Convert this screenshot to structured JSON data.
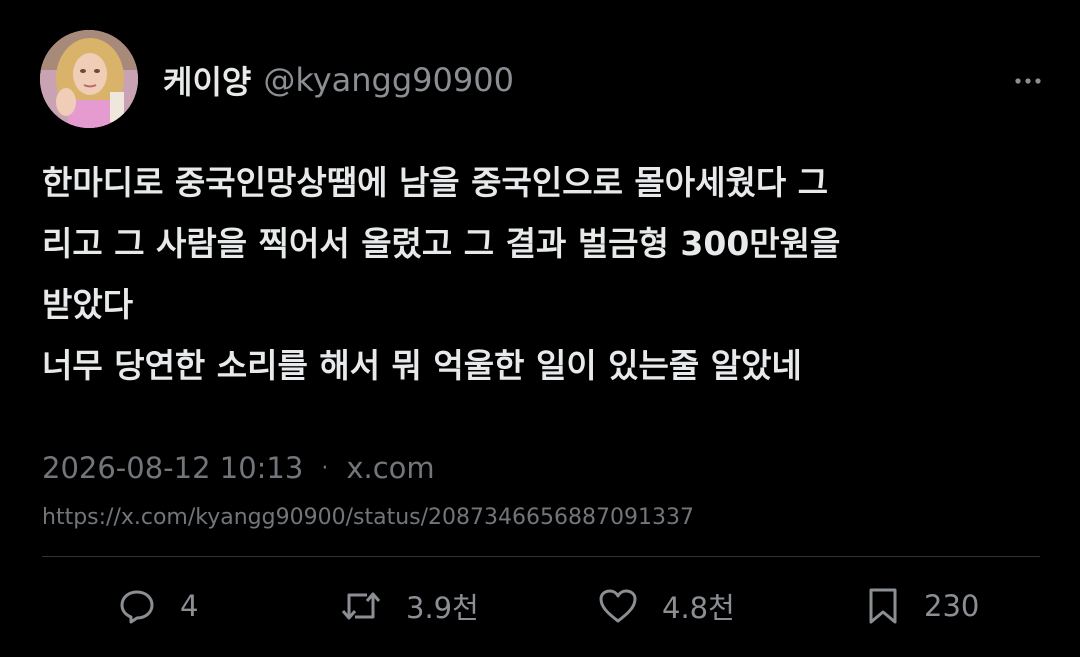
{
  "author": {
    "display_name": "케이양",
    "handle": "@kyangg90900",
    "avatar": "profile-photo"
  },
  "tweet": {
    "lines": [
      "한마디로 중국인망상땜에 남을 중국인으로 몰아세웠다 그",
      "리고 그 사람을 찍어서 올렸고 그 결과 벌금형 300만원을",
      "받았다",
      "너무 당연한 소리를 해서 뭐 억울한 일이 있는줄 알았네"
    ]
  },
  "meta": {
    "timestamp": "2026-08-12 10:13",
    "separator": "·",
    "source": "x.com",
    "url": "https://x.com/kyangg90900/status/2087346656887091337"
  },
  "actions": {
    "reply": {
      "icon": "reply-icon",
      "count": "4"
    },
    "retweet": {
      "icon": "retweet-icon",
      "count": "3.9천"
    },
    "like": {
      "icon": "heart-icon",
      "count": "4.8천"
    },
    "bookmark": {
      "icon": "bookmark-icon",
      "count": "230"
    }
  },
  "colors": {
    "background": "#000000",
    "text": "#e7e9ea",
    "muted": "#72767a",
    "divider": "#2f3336"
  }
}
